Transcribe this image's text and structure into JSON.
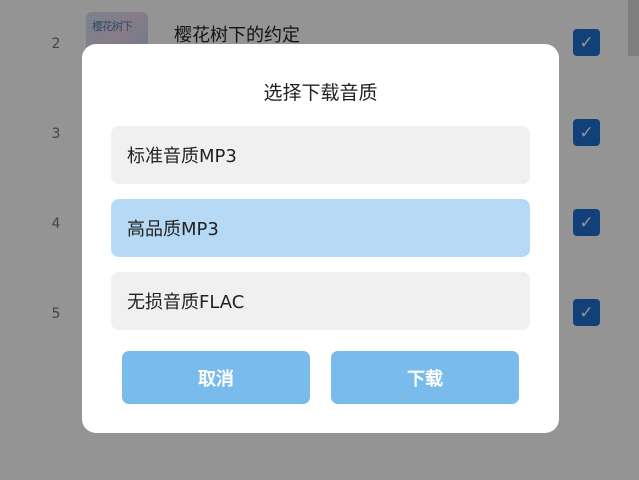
{
  "list": {
    "rows": [
      {
        "index": "2",
        "title": "樱花树下的约定",
        "thumb_text": "樱花树下",
        "checked": true
      },
      {
        "index": "3",
        "checked": true
      },
      {
        "index": "4",
        "checked": true
      },
      {
        "index": "5",
        "checked": true
      }
    ]
  },
  "dialog": {
    "title": "选择下载音质",
    "options": [
      {
        "label": "标准音质MP3",
        "selected": false
      },
      {
        "label": "高品质MP3",
        "selected": true
      },
      {
        "label": "无损音质FLAC",
        "selected": false
      }
    ],
    "cancel_label": "取消",
    "download_label": "下载"
  },
  "colors": {
    "checkbox": "#1f6fd0",
    "selected_option": "#b6d9f5",
    "button": "#79bbeb",
    "overlay": "rgba(0,0,0,0.42)"
  },
  "icons": {
    "checkbox": "checkmark-icon"
  }
}
